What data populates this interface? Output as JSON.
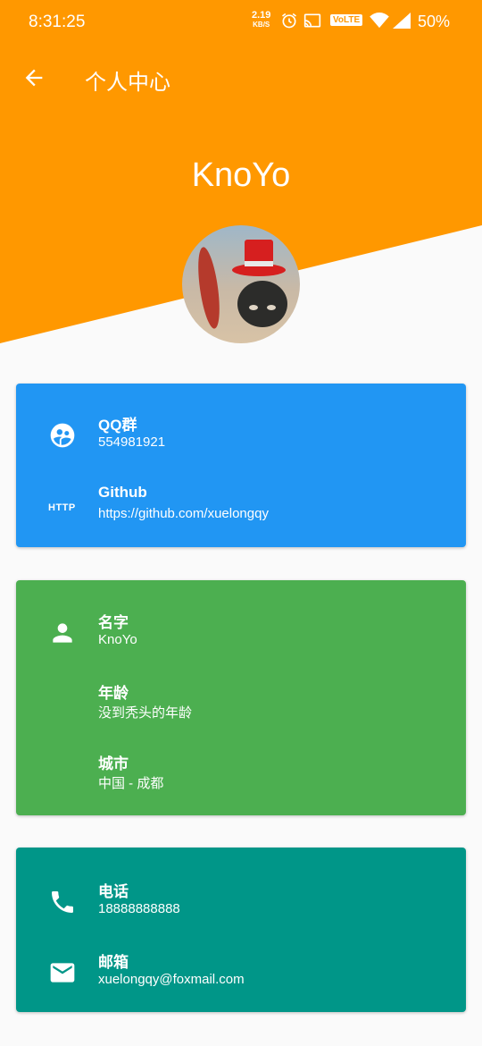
{
  "colors": {
    "header": "#ff9800",
    "card_blue": "#2196f3",
    "card_green": "#4caf50",
    "card_teal": "#009688"
  },
  "status_bar": {
    "time": "8:31:25",
    "speed_value": "2.19",
    "speed_unit": "KB/S",
    "volte": "VoLTE",
    "battery": "50%"
  },
  "app_bar": {
    "title": "个人中心"
  },
  "profile": {
    "name": "KnoYo"
  },
  "card1": {
    "items": [
      {
        "title": "QQ群",
        "sub": "554981921",
        "icon": "group-icon"
      },
      {
        "title": "Github",
        "sub": "https://github.com/xuelongqy",
        "icon": "http-icon",
        "icon_text": "HTTP"
      }
    ]
  },
  "card2": {
    "items": [
      {
        "title": "名字",
        "sub": "KnoYo",
        "icon": "person-icon"
      },
      {
        "title": "年龄",
        "sub": "没到秃头的年龄"
      },
      {
        "title": "城市",
        "sub": "中国 - 成都"
      }
    ]
  },
  "card3": {
    "items": [
      {
        "title": "电话",
        "sub": "18888888888",
        "icon": "phone-icon"
      },
      {
        "title": "邮箱",
        "sub": "xuelongqy@foxmail.com",
        "icon": "email-icon"
      }
    ]
  }
}
